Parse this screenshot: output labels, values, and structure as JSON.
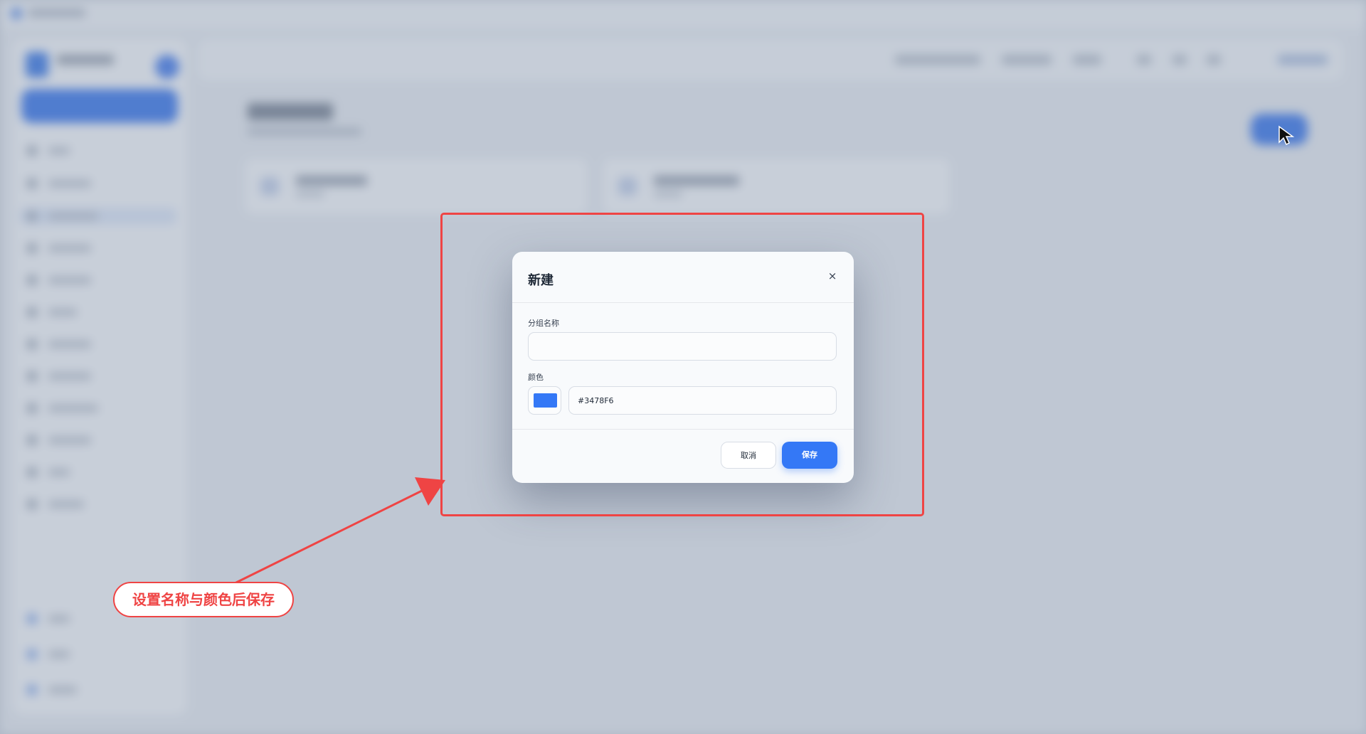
{
  "dialog": {
    "title": "新建",
    "close_icon": "close-icon",
    "close_glyph": "×",
    "group_name_label": "分组名称",
    "group_name_value": "",
    "group_name_placeholder": "",
    "color_label": "颜色",
    "color_value": "#3478F6",
    "cancel_label": "取消",
    "save_label": "保存"
  },
  "annotation": {
    "callout_text": "设置名称与颜色后保存"
  },
  "colors": {
    "accent": "#3478F6",
    "annotation_red": "#EF4444"
  }
}
